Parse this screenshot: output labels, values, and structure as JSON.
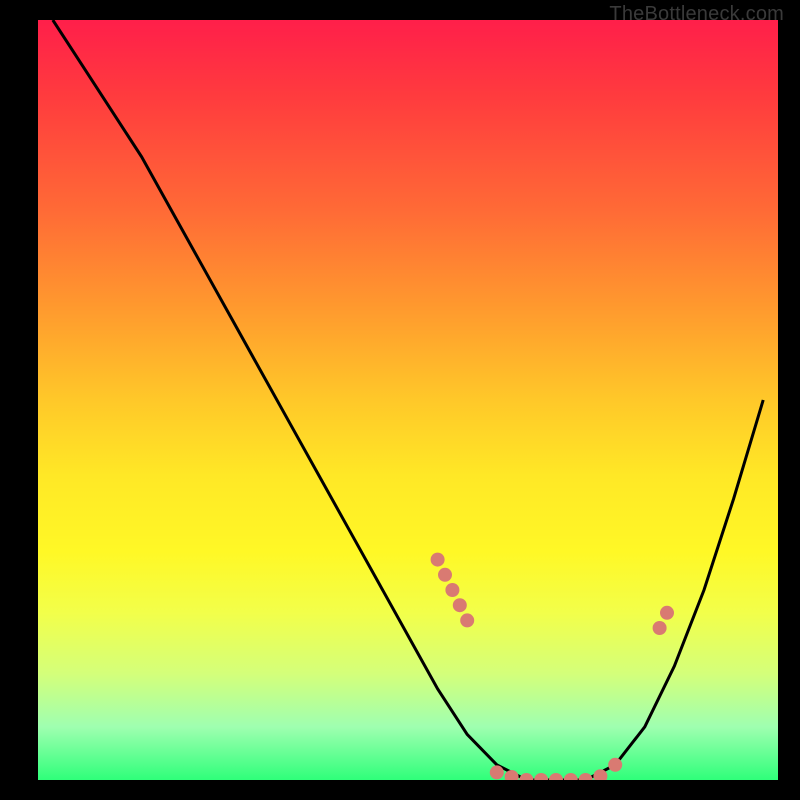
{
  "watermark": "TheBottleneck.com",
  "colors": {
    "background": "#000000",
    "curve": "#000000",
    "dot": "#d97a72"
  },
  "chart_data": {
    "type": "line",
    "title": "",
    "xlabel": "",
    "ylabel": "",
    "xlim": [
      0,
      100
    ],
    "ylim": [
      0,
      100
    ],
    "series": [
      {
        "name": "bottleneck-curve",
        "x": [
          2,
          6,
          10,
          14,
          18,
          22,
          26,
          30,
          34,
          38,
          42,
          46,
          50,
          54,
          58,
          62,
          66,
          70,
          74,
          78,
          82,
          86,
          90,
          94,
          98
        ],
        "y": [
          100,
          94,
          88,
          82,
          75,
          68,
          61,
          54,
          47,
          40,
          33,
          26,
          19,
          12,
          6,
          2,
          0,
          0,
          0,
          2,
          7,
          15,
          25,
          37,
          50
        ]
      }
    ],
    "markers": {
      "name": "highlighted-points",
      "x": [
        54,
        55,
        56,
        57,
        58,
        62,
        64,
        66,
        68,
        70,
        72,
        74,
        76,
        78,
        84,
        85
      ],
      "y": [
        29,
        27,
        25,
        23,
        21,
        1,
        0.4,
        0,
        0,
        0,
        0,
        0,
        0.5,
        2,
        20,
        22
      ]
    }
  }
}
